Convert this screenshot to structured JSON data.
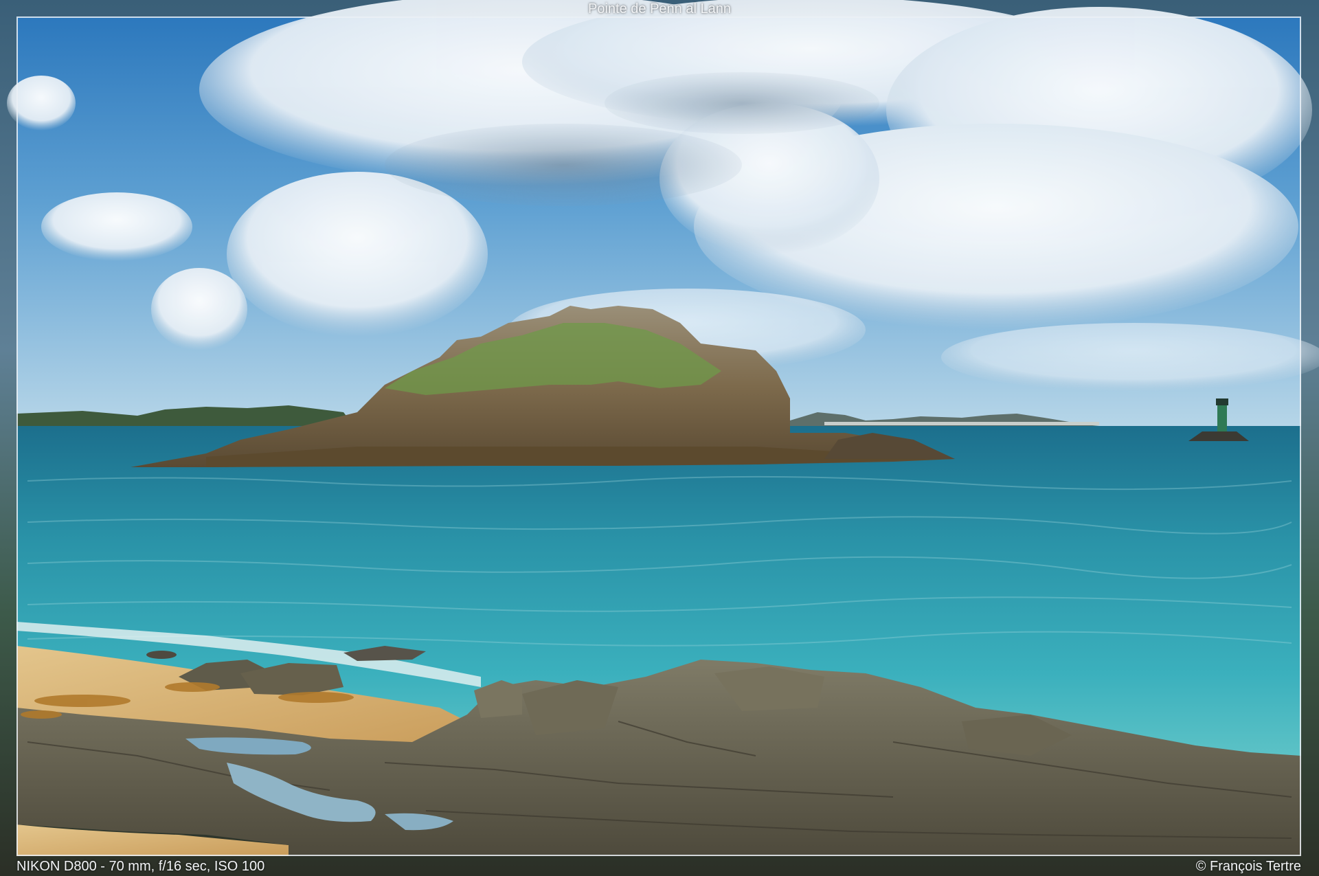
{
  "photo": {
    "title": "Pointe de Penn al Lann",
    "exif": "NIKON D800 - 70 mm, f/16 sec, ISO 100",
    "copyright": "© François Tertre"
  },
  "colors": {
    "sky_top": "#2f7fc4",
    "sky_horizon": "#a9cfe6",
    "sea_deep": "#1f7f9a",
    "sea_shallow": "#33a6b4",
    "rock": "#6e6a58",
    "sand": "#d8b57a",
    "foliage": "#6f9a4a",
    "caption_text": "#f2f4f6"
  }
}
